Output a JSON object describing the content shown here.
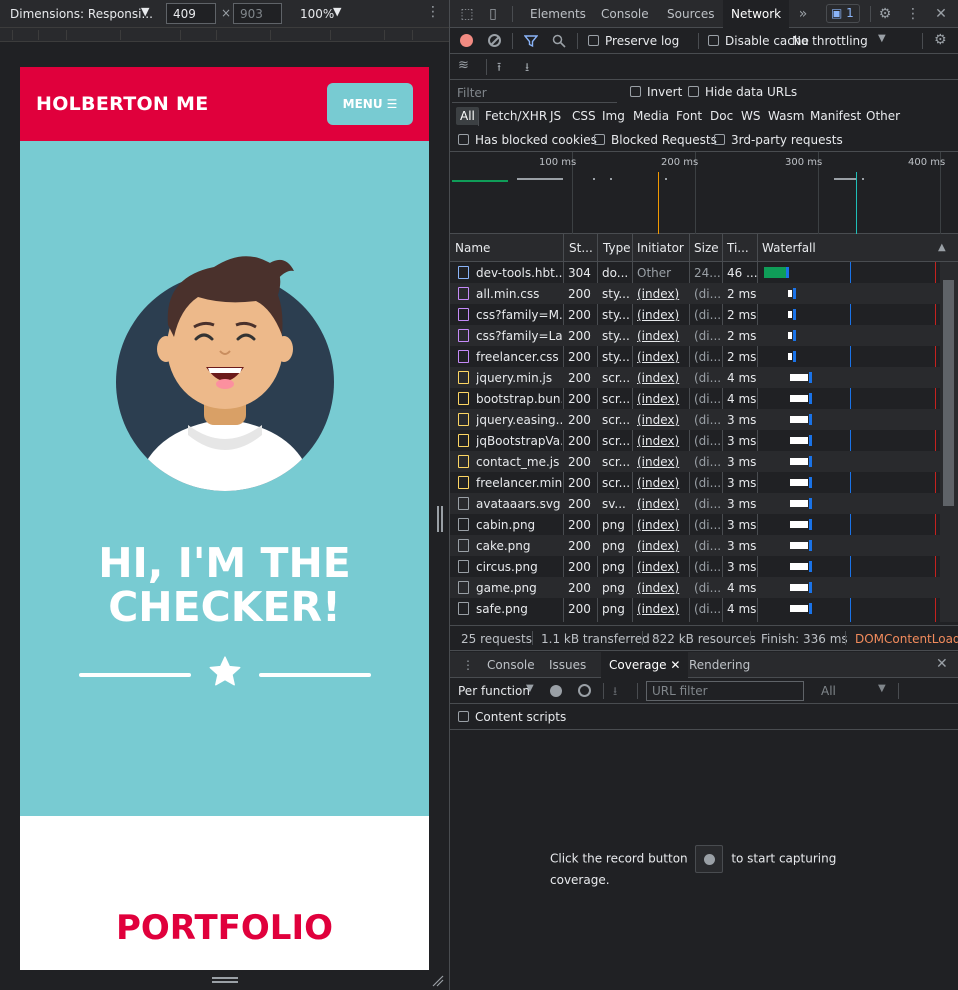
{
  "device_toolbar": {
    "dimensions_label": "Dimensions: Responsi...",
    "width": "409",
    "height_placeholder": "903",
    "zoom": "100%"
  },
  "site": {
    "brand": "HOLBERTON ME",
    "menu_label": "MENU",
    "hero_title_line1": "HI, I'M THE",
    "hero_title_line2": "CHECKER!",
    "portfolio_title": "PORTFOLIO",
    "colors": {
      "nav": "#e0003c",
      "hero": "#78cbd2",
      "accent": "#e0003c"
    }
  },
  "devtools": {
    "tabs": [
      "Elements",
      "Console",
      "Sources",
      "Network"
    ],
    "active_tab": "Network",
    "issues_count": "1",
    "network_toolbar": {
      "preserve_log": "Preserve log",
      "disable_cache": "Disable cache",
      "throttling": "No throttling"
    },
    "filter": {
      "placeholder": "Filter",
      "invert": "Invert",
      "hide_data_urls": "Hide data URLs",
      "types": [
        "All",
        "Fetch/XHR",
        "JS",
        "CSS",
        "Img",
        "Media",
        "Font",
        "Doc",
        "WS",
        "Wasm",
        "Manifest",
        "Other"
      ],
      "has_blocked_cookies": "Has blocked cookies",
      "blocked_requests": "Blocked Requests",
      "third_party": "3rd-party requests"
    },
    "overview_ticks": [
      "100 ms",
      "200 ms",
      "300 ms",
      "400 ms"
    ],
    "columns": [
      "Name",
      "St...",
      "Type",
      "Initiator",
      "Size",
      "Ti...",
      "Waterfall"
    ],
    "rows": [
      {
        "name": "dev-tools.hbt...",
        "status": "304",
        "type": "do...",
        "initiator": "Other",
        "size": "24...",
        "time": "46 ...",
        "icon": "document-icon"
      },
      {
        "name": "all.min.css",
        "status": "200",
        "type": "sty...",
        "initiator": "(index)",
        "size": "(di...",
        "time": "2 ms",
        "icon": "stylesheet-icon"
      },
      {
        "name": "css?family=M...",
        "status": "200",
        "type": "sty...",
        "initiator": "(index)",
        "size": "(di...",
        "time": "2 ms",
        "icon": "stylesheet-icon"
      },
      {
        "name": "css?family=La...",
        "status": "200",
        "type": "sty...",
        "initiator": "(index)",
        "size": "(di...",
        "time": "2 ms",
        "icon": "stylesheet-icon"
      },
      {
        "name": "freelancer.css",
        "status": "200",
        "type": "sty...",
        "initiator": "(index)",
        "size": "(di...",
        "time": "2 ms",
        "icon": "stylesheet-icon"
      },
      {
        "name": "jquery.min.js",
        "status": "200",
        "type": "scr...",
        "initiator": "(index)",
        "size": "(di...",
        "time": "4 ms",
        "icon": "script-icon"
      },
      {
        "name": "bootstrap.bun...",
        "status": "200",
        "type": "scr...",
        "initiator": "(index)",
        "size": "(di...",
        "time": "4 ms",
        "icon": "script-icon"
      },
      {
        "name": "jquery.easing....",
        "status": "200",
        "type": "scr...",
        "initiator": "(index)",
        "size": "(di...",
        "time": "3 ms",
        "icon": "script-icon"
      },
      {
        "name": "jqBootstrapVa...",
        "status": "200",
        "type": "scr...",
        "initiator": "(index)",
        "size": "(di...",
        "time": "3 ms",
        "icon": "script-icon"
      },
      {
        "name": "contact_me.js",
        "status": "200",
        "type": "scr...",
        "initiator": "(index)",
        "size": "(di...",
        "time": "3 ms",
        "icon": "script-icon"
      },
      {
        "name": "freelancer.min...",
        "status": "200",
        "type": "scr...",
        "initiator": "(index)",
        "size": "(di...",
        "time": "3 ms",
        "icon": "script-icon"
      },
      {
        "name": "avataaars.svg",
        "status": "200",
        "type": "sv...",
        "initiator": "(index)",
        "size": "(di...",
        "time": "3 ms",
        "icon": "image-icon"
      },
      {
        "name": "cabin.png",
        "status": "200",
        "type": "png",
        "initiator": "(index)",
        "size": "(di...",
        "time": "3 ms",
        "icon": "image-icon"
      },
      {
        "name": "cake.png",
        "status": "200",
        "type": "png",
        "initiator": "(index)",
        "size": "(di...",
        "time": "3 ms",
        "icon": "image-icon"
      },
      {
        "name": "circus.png",
        "status": "200",
        "type": "png",
        "initiator": "(index)",
        "size": "(di...",
        "time": "3 ms",
        "icon": "image-icon"
      },
      {
        "name": "game.png",
        "status": "200",
        "type": "png",
        "initiator": "(index)",
        "size": "(di...",
        "time": "4 ms",
        "icon": "image-icon"
      },
      {
        "name": "safe.png",
        "status": "200",
        "type": "png",
        "initiator": "(index)",
        "size": "(di...",
        "time": "4 ms",
        "icon": "image-icon"
      }
    ],
    "status_bar": {
      "requests": "25 requests",
      "transferred": "1.1 kB transferred",
      "resources": "822 kB resources",
      "finish": "Finish: 336 ms",
      "dom_content_loaded": "DOMContentLoade"
    },
    "drawer": {
      "tabs": [
        "Console",
        "Issues",
        "Coverage",
        "Rendering"
      ],
      "active_tab": "Coverage",
      "per_function": "Per function",
      "url_filter_placeholder": "URL filter",
      "type_select": "All",
      "content_scripts": "Content scripts",
      "message_before": "Click the record button",
      "message_after": "to start capturing coverage."
    }
  }
}
